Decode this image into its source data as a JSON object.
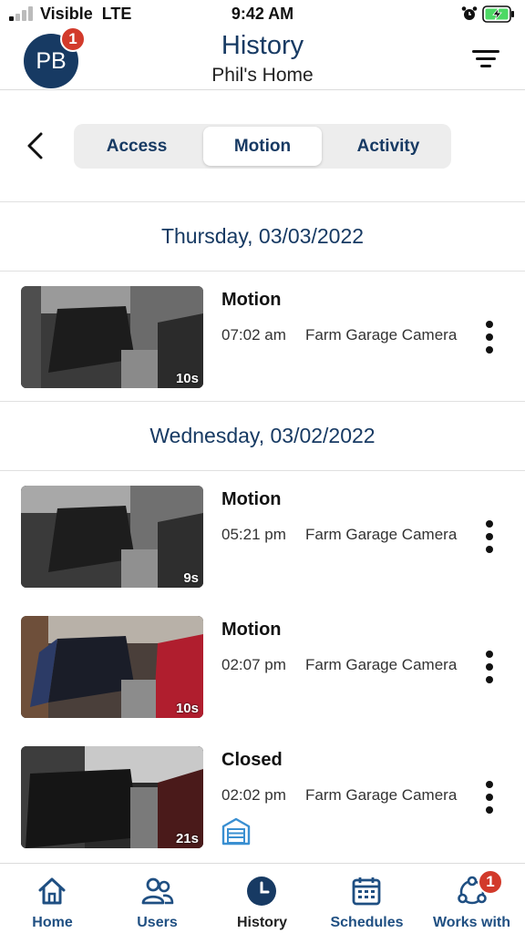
{
  "status_bar": {
    "carrier": "Visible",
    "network": "LTE",
    "time": "9:42 AM"
  },
  "header": {
    "avatar_initials": "PB",
    "avatar_badge": "1",
    "title": "History",
    "subtitle": "Phil's Home"
  },
  "tabs": [
    {
      "label": "Access",
      "active": false
    },
    {
      "label": "Motion",
      "active": true
    },
    {
      "label": "Activity",
      "active": false
    }
  ],
  "groups": [
    {
      "date": "Thursday, 03/03/2022",
      "events": [
        {
          "title": "Motion",
          "time": "07:02 am",
          "camera": "Farm Garage Camera",
          "duration": "10s"
        }
      ]
    },
    {
      "date": "Wednesday, 03/02/2022",
      "events": [
        {
          "title": "Motion",
          "time": "05:21 pm",
          "camera": "Farm Garage Camera",
          "duration": "9s"
        },
        {
          "title": "Motion",
          "time": "02:07 pm",
          "camera": "Farm Garage Camera",
          "duration": "10s"
        },
        {
          "title": "Closed",
          "time": "02:02 pm",
          "camera": "Farm Garage Camera",
          "duration": "21s",
          "icon": "garage-door-icon"
        }
      ]
    }
  ],
  "bottom_nav": [
    {
      "label": "Home",
      "icon": "home-icon",
      "active": false
    },
    {
      "label": "Users",
      "icon": "users-icon",
      "active": false
    },
    {
      "label": "History",
      "icon": "clock-icon",
      "active": true
    },
    {
      "label": "Schedules",
      "icon": "calendar-icon",
      "active": false
    },
    {
      "label": "Works with",
      "icon": "connections-icon",
      "active": false,
      "badge": "1"
    }
  ],
  "colors": {
    "brand_navy": "#173a63",
    "nav_blue": "#1f4f82",
    "badge_red": "#d23a2b",
    "battery_green": "#4cd964"
  }
}
